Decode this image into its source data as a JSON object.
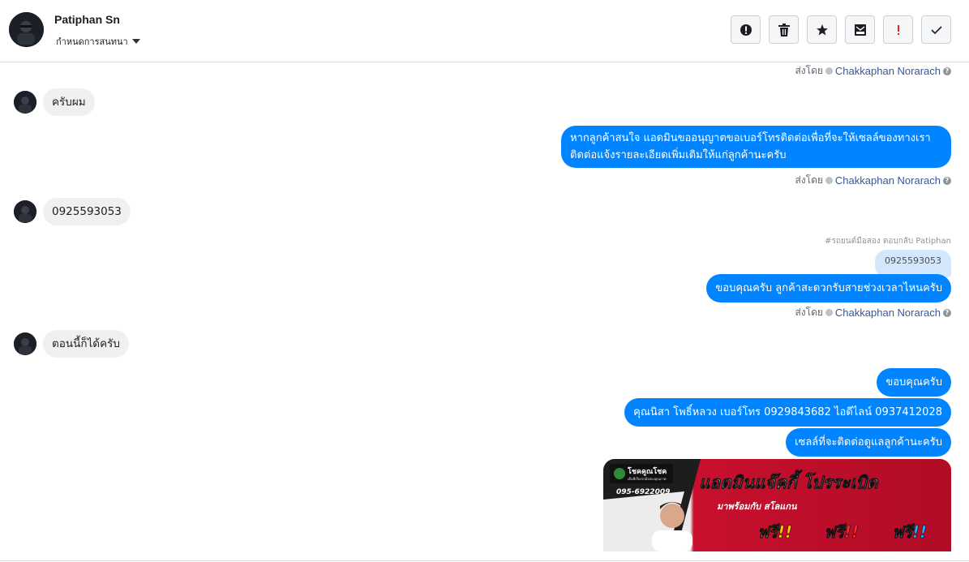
{
  "header": {
    "name": "Patiphan Sn",
    "subtitle": "กำหนดการสนทนา"
  },
  "toolbar": {
    "buttons": [
      {
        "icon": "alert-circle-icon"
      },
      {
        "icon": "trash-icon"
      },
      {
        "icon": "star-icon"
      },
      {
        "icon": "mark-unread-icon"
      },
      {
        "icon": "exclamation-icon"
      },
      {
        "icon": "checkmark-icon"
      }
    ]
  },
  "sent_by_prefix": "ส่งโดย",
  "agent_name": "Chakkaphan Norarach",
  "messages": {
    "in_1": "ครับผม",
    "out_1": "หากลูกค้าสนใจ แอดมินขออนุญาตขอเบอร์โทรติดต่อเพื่อที่จะให้เซลล์ของทางเราติดต่อแจ้งรายละเอียดเพิ่มเติมให้แก่ลูกค้านะครับ",
    "in_2": "0925593053",
    "reply_hint": "#รถยนต์มือสอง ตอบกลับ Patiphan",
    "quoted": "0925593053",
    "out_2": "ขอบคุณครับ ลูกค้าสะดวกรับสายช่วงเวลาไหนครับ",
    "in_3": "ตอนนี้ก็ได้ครับ",
    "out_3": "ขอบคุณครับ",
    "out_4": "คุณนิสา โพธิ์หลวง  เบอร์โทร 0929843682  ไอดีไลน์ 0937412028",
    "out_5": "เซลล์ที่จะติดต่อดูแลลูกค้านะครับ"
  },
  "image_card": {
    "brand": "โชคคูณโชค",
    "brand_sub": "เต็มที่เรื่องรถมือสองคุณภาพ",
    "phone": "095-6922009",
    "headline": "แอดมินแจ๊คกี้ โปรระเบิด",
    "subline": "มาพร้อมกับ สโลแกน",
    "free_label": "ฟรี!!",
    "primary_color": "#c8102e"
  },
  "colors": {
    "outgoing_bubble": "#0084ff",
    "incoming_bubble": "#f1f0f0",
    "agent_link": "#385898"
  }
}
